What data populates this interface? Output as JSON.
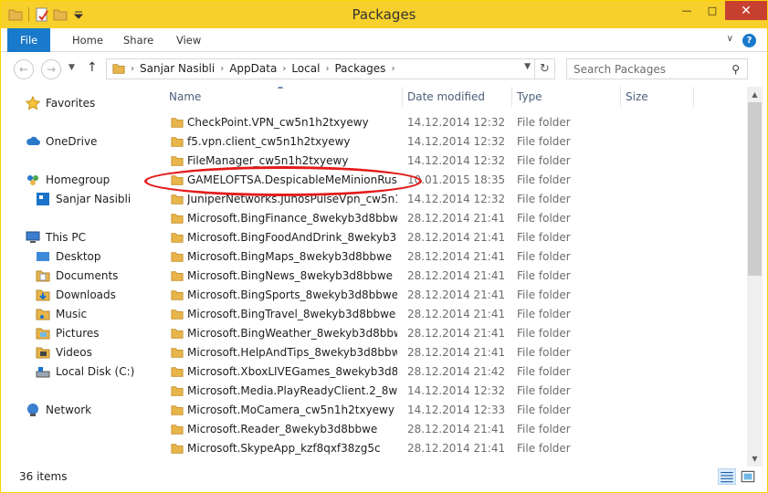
{
  "window": {
    "title": "Packages"
  },
  "ribbon": {
    "tabs": [
      "File",
      "Home",
      "Share",
      "View"
    ]
  },
  "address": {
    "crumbs": [
      "Sanjar Nasibli",
      "AppData",
      "Local",
      "Packages"
    ]
  },
  "search": {
    "placeholder": "Search Packages"
  },
  "nav": {
    "favorites": "Favorites",
    "onedrive": "OneDrive",
    "homegroup": "Homegroup",
    "homegroup_user": "Sanjar Nasibli",
    "thispc": "This PC",
    "pc_items": [
      "Desktop",
      "Documents",
      "Downloads",
      "Music",
      "Pictures",
      "Videos",
      "Local Disk (C:)"
    ],
    "network": "Network"
  },
  "columns": {
    "name": "Name",
    "date": "Date modified",
    "type": "Type",
    "size": "Size"
  },
  "files": [
    {
      "name": "CheckPoint.VPN_cw5n1h2txyewy",
      "date": "14.12.2014 12:32",
      "type": "File folder"
    },
    {
      "name": "f5.vpn.client_cw5n1h2txyewy",
      "date": "14.12.2014 12:32",
      "type": "File folder"
    },
    {
      "name": "FileManager_cw5n1h2txyewy",
      "date": "14.12.2014 12:32",
      "type": "File folder"
    },
    {
      "name": "GAMELOFTSA.DespicableMeMinionRush...",
      "date": "10.01.2015 18:35",
      "type": "File folder"
    },
    {
      "name": "JuniperNetworks.JunosPulseVpn_cw5n1h...",
      "date": "14.12.2014 12:32",
      "type": "File folder"
    },
    {
      "name": "Microsoft.BingFinance_8wekyb3d8bbwe",
      "date": "28.12.2014 21:41",
      "type": "File folder"
    },
    {
      "name": "Microsoft.BingFoodAndDrink_8wekyb3d...",
      "date": "28.12.2014 21:41",
      "type": "File folder"
    },
    {
      "name": "Microsoft.BingMaps_8wekyb3d8bbwe",
      "date": "28.12.2014 21:41",
      "type": "File folder"
    },
    {
      "name": "Microsoft.BingNews_8wekyb3d8bbwe",
      "date": "28.12.2014 21:41",
      "type": "File folder"
    },
    {
      "name": "Microsoft.BingSports_8wekyb3d8bbwe",
      "date": "28.12.2014 21:41",
      "type": "File folder"
    },
    {
      "name": "Microsoft.BingTravel_8wekyb3d8bbwe",
      "date": "28.12.2014 21:41",
      "type": "File folder"
    },
    {
      "name": "Microsoft.BingWeather_8wekyb3d8bbwe",
      "date": "28.12.2014 21:41",
      "type": "File folder"
    },
    {
      "name": "Microsoft.HelpAndTips_8wekyb3d8bbwe",
      "date": "28.12.2014 21:41",
      "type": "File folder"
    },
    {
      "name": "Microsoft.XboxLIVEGames_8wekyb3d8bb...",
      "date": "28.12.2014 21:42",
      "type": "File folder"
    },
    {
      "name": "Microsoft.Media.PlayReadyClient.2_8wek...",
      "date": "14.12.2014 12:32",
      "type": "File folder"
    },
    {
      "name": "Microsoft.MoCamera_cw5n1h2txyewy",
      "date": "14.12.2014 12:33",
      "type": "File folder"
    },
    {
      "name": "Microsoft.Reader_8wekyb3d8bbwe",
      "date": "28.12.2014 21:41",
      "type": "File folder"
    },
    {
      "name": "Microsoft.SkypeApp_kzf8qxf38zg5c",
      "date": "28.12.2014 21:41",
      "type": "File folder"
    }
  ],
  "status": {
    "count": "36 items"
  },
  "colors": {
    "accent": "#1979ca",
    "titlebar": "#f7d02c",
    "folder": "#e8b54a",
    "annotation": "#e31b1b"
  },
  "icons": {
    "folder": "folder-icon",
    "favorites": "star-icon",
    "onedrive": "cloud-icon",
    "homegroup": "homegroup-icon",
    "thispc": "computer-icon",
    "network": "network-icon"
  }
}
